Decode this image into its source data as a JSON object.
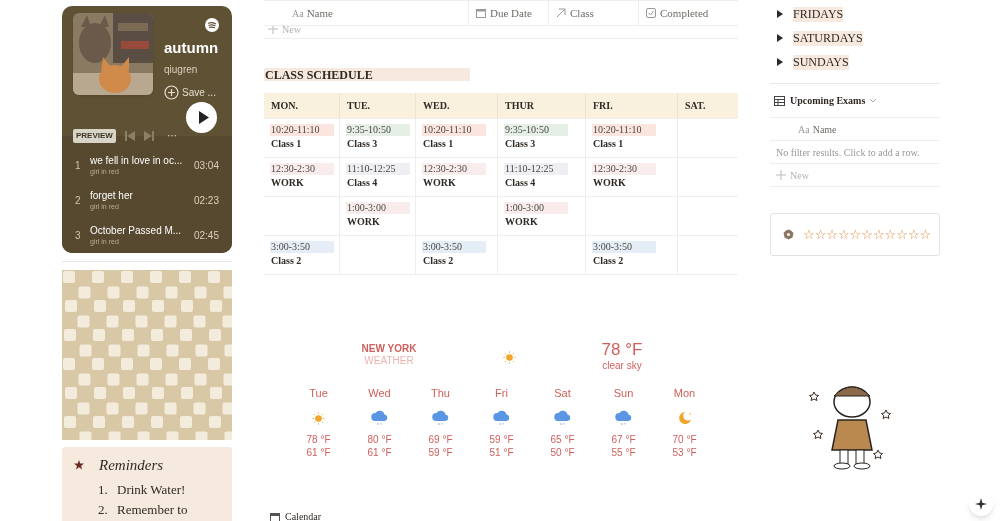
{
  "player": {
    "title": "autumn",
    "owner": "qiugren",
    "save": "Save ...",
    "preview": "PREVIEW",
    "more": "···",
    "tracks": [
      {
        "number": "1",
        "title": "we fell in love in oc...",
        "artist": "girl in red",
        "duration": "03:04"
      },
      {
        "number": "2",
        "title": "forget her",
        "artist": "girl in red",
        "duration": "02:23"
      },
      {
        "number": "3",
        "title": "October Passed M...",
        "artist": "girl in red",
        "duration": "02:45"
      }
    ]
  },
  "reminders": {
    "title": "Reminders",
    "items": [
      {
        "number": "1.",
        "text": "Drink Water!"
      },
      {
        "number": "2.",
        "text": "Remember to"
      }
    ]
  },
  "assignments": {
    "columns": [
      {
        "kind": "text",
        "marker": "Aa",
        "label": "Name"
      },
      {
        "kind": "date",
        "label": "Due Date"
      },
      {
        "kind": "relation",
        "label": "Class"
      },
      {
        "kind": "checkbox",
        "label": "Completed"
      }
    ],
    "new": "New"
  },
  "schedule": {
    "title": "CLASS SCHEDULE",
    "columns": [
      "MON.",
      "TUE.",
      "WED.",
      "THUR",
      "FRI.",
      "SAT."
    ],
    "rows": [
      [
        {
          "time": "10:20-11:10",
          "label": "Class 1",
          "color": "#fbe6df"
        },
        {
          "time": "9:35-10:50",
          "label": "Class 3",
          "color": "#e6efe6"
        },
        {
          "time": "10:20-11:10",
          "label": "Class 1",
          "color": "#fbe6df"
        },
        {
          "time": "9:35-10:50",
          "label": "Class 3",
          "color": "#e6efe6"
        },
        {
          "time": "10:20-11:10",
          "label": "Class 1",
          "color": "#fbe6df"
        },
        null
      ],
      [
        {
          "time": "12:30-2:30",
          "label": "WORK",
          "color": "#f9ecec"
        },
        {
          "time": "11:10-12:25",
          "label": "Class 4",
          "color": "#eeeff3"
        },
        {
          "time": "12:30-2:30",
          "label": "WORK",
          "color": "#f9ecec"
        },
        {
          "time": "11:10-12:25",
          "label": "Class 4",
          "color": "#eeeff3"
        },
        {
          "time": "12:30-2:30",
          "label": "WORK",
          "color": "#f9ecec"
        },
        null
      ],
      [
        null,
        {
          "time": "1:00-3:00",
          "label": "WORK",
          "color": "#f9ecec"
        },
        null,
        {
          "time": "1:00-3:00",
          "label": "WORK",
          "color": "#f9ecec"
        },
        null,
        null
      ],
      [
        {
          "time": "3:00-3:50",
          "label": "Class 2",
          "color": "#e5eef6"
        },
        null,
        {
          "time": "3:00-3:50",
          "label": "Class 2",
          "color": "#e5eef6"
        },
        null,
        {
          "time": "3:00-3:50",
          "label": "Class 2",
          "color": "#e5eef6"
        },
        null
      ]
    ]
  },
  "weather": {
    "city": "NEW YORK",
    "subtitle": "WEATHER",
    "current": {
      "kind": "sun",
      "temperature": "78 °F",
      "condition": "clear sky"
    },
    "days": [
      {
        "day": "Tue",
        "kind": "sun",
        "high": "78 °F",
        "low": "61 °F"
      },
      {
        "day": "Wed",
        "kind": "rain",
        "high": "80 °F",
        "low": "61 °F"
      },
      {
        "day": "Thu",
        "kind": "rain",
        "high": "69 °F",
        "low": "59 °F"
      },
      {
        "day": "Fri",
        "kind": "rain",
        "high": "59 °F",
        "low": "51 °F"
      },
      {
        "day": "Sat",
        "kind": "rain",
        "high": "65 °F",
        "low": "50 °F"
      },
      {
        "day": "Sun",
        "kind": "rain",
        "high": "67 °F",
        "low": "55 °F"
      },
      {
        "day": "Mon",
        "kind": "moon",
        "high": "70 °F",
        "low": "53 °F"
      }
    ]
  },
  "calendar": {
    "title": "Calendar"
  },
  "toggles": [
    {
      "label": "FRIDAYS",
      "expanded": false
    },
    {
      "label": "SATURDAYS",
      "expanded": false
    },
    {
      "label": "SUNDAYS",
      "expanded": false
    }
  ],
  "exams": {
    "title": "Upcoming Exams",
    "column_marker": "Aa",
    "column": "Name",
    "empty": "No filter results. Click to add a row.",
    "new": "New"
  },
  "rating": {
    "stars_text": "☆☆☆☆☆☆☆☆☆☆☆"
  }
}
